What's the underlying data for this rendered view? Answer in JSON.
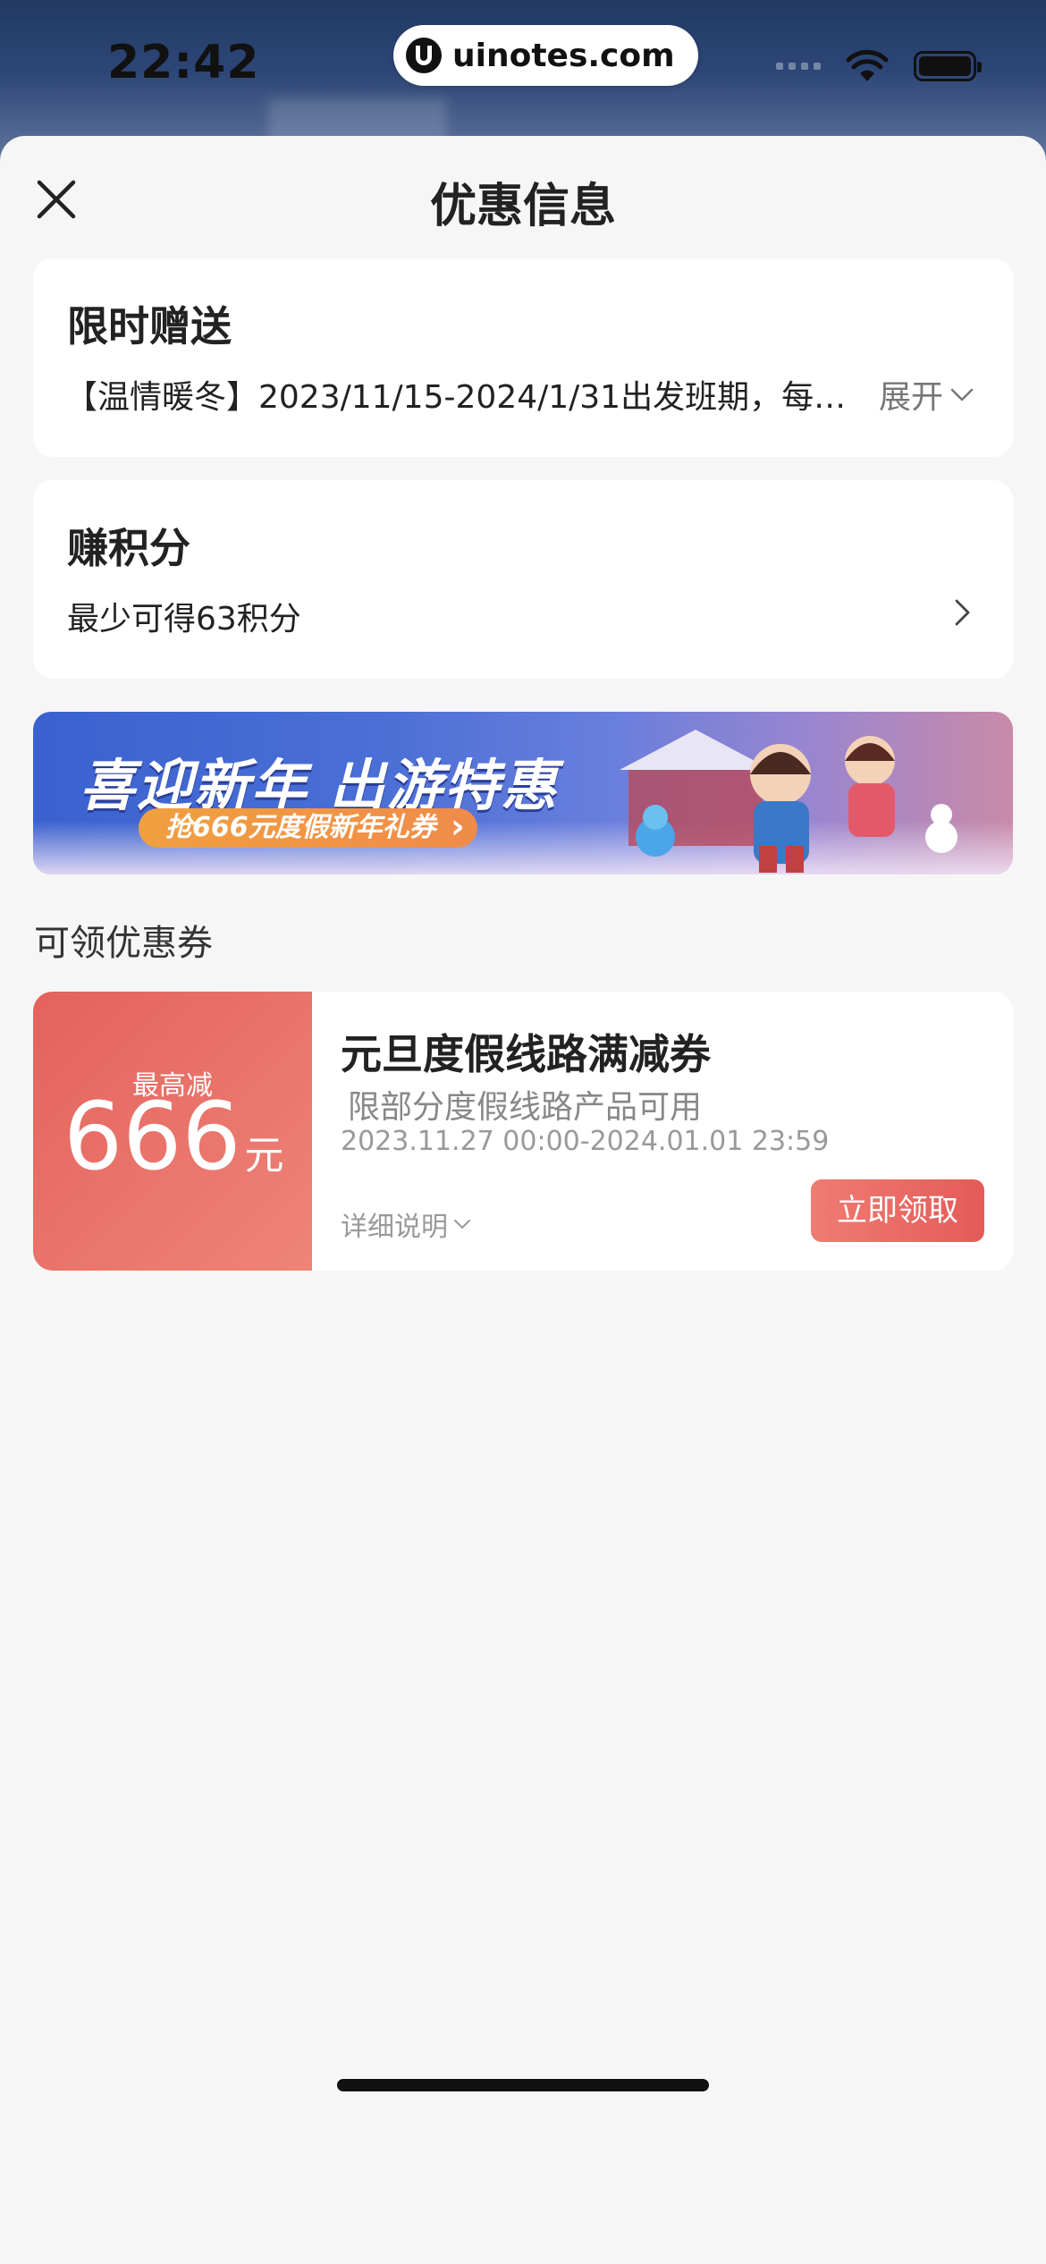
{
  "status_bar": {
    "time": "22:42",
    "watermark": "uinotes.com"
  },
  "sheet": {
    "title": "优惠信息"
  },
  "gift": {
    "title": "限时赠送",
    "desc": "【温情暖冬】2023/11/15-2024/1/31出发班期，每…",
    "expand_label": "展开"
  },
  "points": {
    "title": "赚积分",
    "desc": "最少可得63积分"
  },
  "banner": {
    "title": "喜迎新年 出游特惠",
    "subtitle": "抢666元度假新年礼券"
  },
  "coupons_section": {
    "label": "可领优惠券",
    "items": [
      {
        "max_label": "最高减",
        "amount": "666",
        "unit": "元",
        "title": "元旦度假线路满减券",
        "scope": "限部分度假线路产品可用",
        "date_range": "2023.11.27 00:00-2024.01.01 23:59",
        "detail_label": "详细说明",
        "claim_label": "立即领取"
      }
    ]
  },
  "colors": {
    "accent": "#e45b58",
    "sheet_bg": "#f6f6f7"
  },
  "icons": [
    "close-icon",
    "chevron-down-icon",
    "chevron-right-icon",
    "wifi-icon",
    "battery-icon",
    "signal-icon"
  ]
}
